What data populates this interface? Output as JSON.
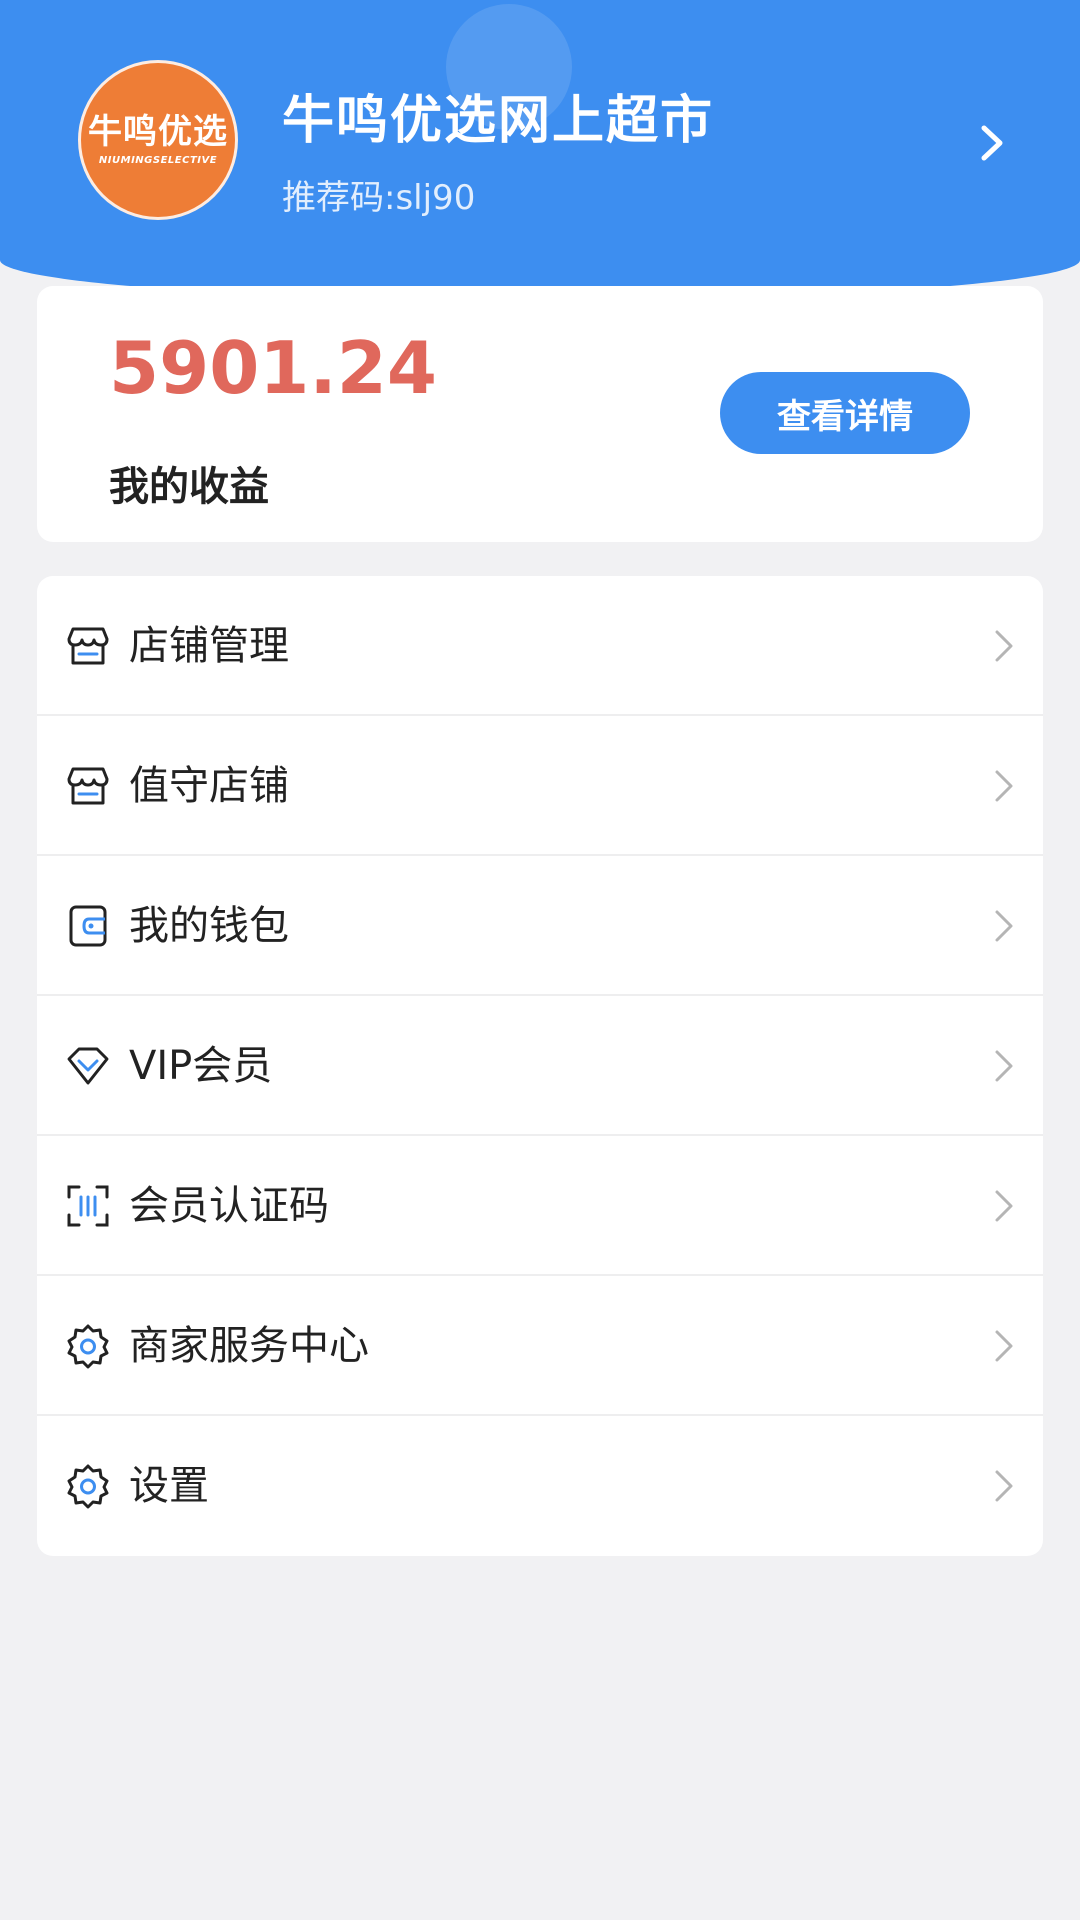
{
  "header": {
    "logo": {
      "text": "牛鸣优选",
      "subtext": "NIUMINGSELECTIVE",
      "icon": "brand-logo"
    },
    "store_name": "牛鸣优选网上超市",
    "referral_code": "推荐码:slj90",
    "chevron_icon": "chevron-right-icon"
  },
  "earnings": {
    "amount": "5901.24",
    "label": "我的收益",
    "detail_button": "查看详情"
  },
  "menu": {
    "items": [
      {
        "label": "店铺管理",
        "icon": "store-icon"
      },
      {
        "label": "值守店铺",
        "icon": "store-icon"
      },
      {
        "label": "我的钱包",
        "icon": "wallet-icon"
      },
      {
        "label": "VIP会员",
        "icon": "diamond-icon"
      },
      {
        "label": "会员认证码",
        "icon": "scan-code-icon"
      },
      {
        "label": "商家服务中心",
        "icon": "gear-icon"
      },
      {
        "label": "设置",
        "icon": "gear-icon"
      }
    ]
  },
  "colors": {
    "primary": "#3d8ef0",
    "amount": "#e0685c",
    "logo_bg": "#ee7d36",
    "background": "#f1f1f3"
  }
}
